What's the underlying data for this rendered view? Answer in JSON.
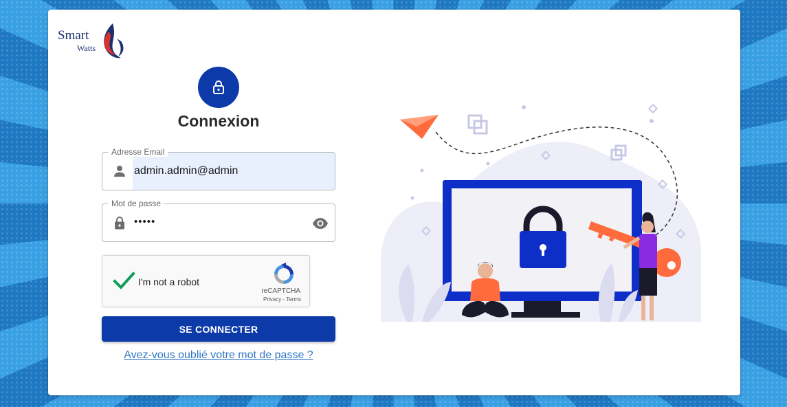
{
  "brand": {
    "name_line1": "Smart",
    "name_line2": "Watts"
  },
  "form": {
    "title": "Connexion",
    "email": {
      "label": "Adresse Email",
      "value": "admin.admin@admin"
    },
    "password": {
      "label": "Mot de passe",
      "value": "•••••"
    },
    "recaptcha": {
      "label": "I'm not a robot",
      "brand": "reCAPTCHA",
      "links": "Privacy - Terms"
    },
    "submit_label": "SE CONNECTER",
    "forgot_label": "Avez-vous oublié votre mot de passe ?"
  },
  "icons": {
    "badge": "lock-icon",
    "email": "person-icon",
    "password": "lock-icon",
    "visibility": "eye-icon",
    "recaptcha_check": "checkmark-icon"
  },
  "colors": {
    "primary": "#0d3aa9",
    "link": "#2e74c4",
    "autofill": "#e8f0fe",
    "check": "#0f9d58",
    "illustration_accent": "#ff6b3d",
    "illustration_purple": "#8a2be2"
  }
}
